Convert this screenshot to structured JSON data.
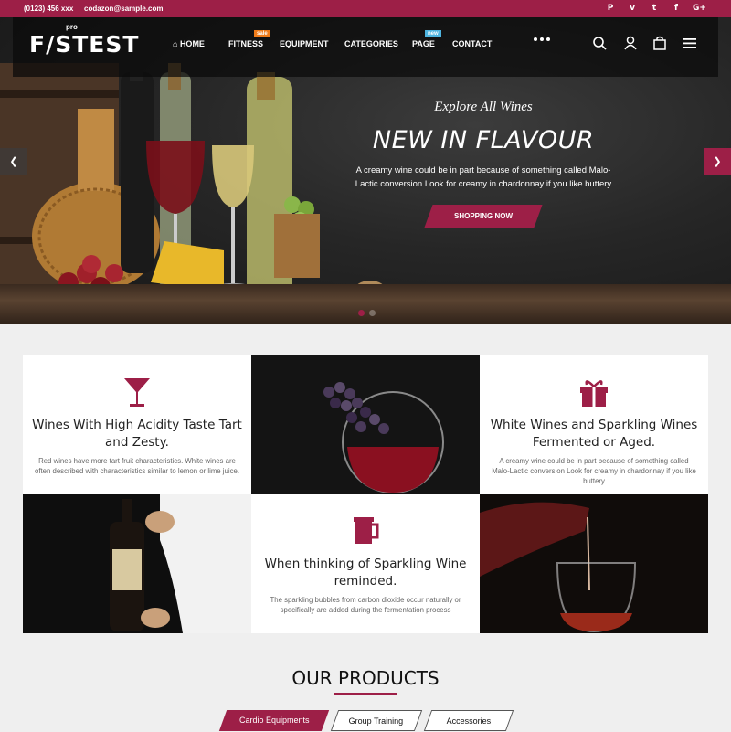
{
  "topbar": {
    "phone": "(0123) 456 xxx",
    "email": "codazon@sample.com",
    "socials": [
      {
        "icon": "pinterest-icon",
        "glyph": "P"
      },
      {
        "icon": "vimeo-icon",
        "glyph": "v"
      },
      {
        "icon": "twitter-icon",
        "glyph": "t"
      },
      {
        "icon": "facebook-icon",
        "glyph": "f"
      },
      {
        "icon": "google-plus-icon",
        "glyph": "G+"
      }
    ]
  },
  "logo": {
    "text": "F/STEST",
    "pro": "pro"
  },
  "nav": {
    "home": "HOME",
    "fitness": "FITNESS",
    "fitness_badge": "sale",
    "equipment": "EQUIPMENT",
    "categories": "CATEGORIES",
    "page": "PAGE",
    "page_badge": "new",
    "contact": "CONTACT"
  },
  "hero": {
    "subtitle": "Explore All Wines",
    "title": "NEW IN FLAVOUR",
    "description": "A creamy wine could be in part because of something called Malo-Lactic conversion Look for creamy in chardonnay if you like buttery",
    "button": "SHOPPING NOW"
  },
  "features": [
    {
      "title": "Wines With High Acidity Taste Tart and Zesty.",
      "text": "Red wines have more tart fruit characteristics. White wines are often described with characteristics similar to lemon or lime juice.",
      "icon": "wine-glass-icon"
    },
    {
      "title": "White Wines and Sparkling Wines Fermented or Aged.",
      "text": "A creamy wine could be in part because of something called Malo-Lactic conversion Look for creamy in chardonnay if you like buttery",
      "icon": "gift-icon"
    },
    {
      "title": "When thinking of Sparkling Wine reminded.",
      "text": "The sparkling bubbles from carbon dioxide occur naturally or specifically are added during the fermentation process",
      "icon": "beer-mug-icon"
    }
  ],
  "products": {
    "title": "OUR PRODUCTS",
    "tabs": [
      "Cardio Equipments",
      "Group Training",
      "Accessories"
    ]
  },
  "colors": {
    "accent": "#9d1f47",
    "dark": "#151515"
  }
}
